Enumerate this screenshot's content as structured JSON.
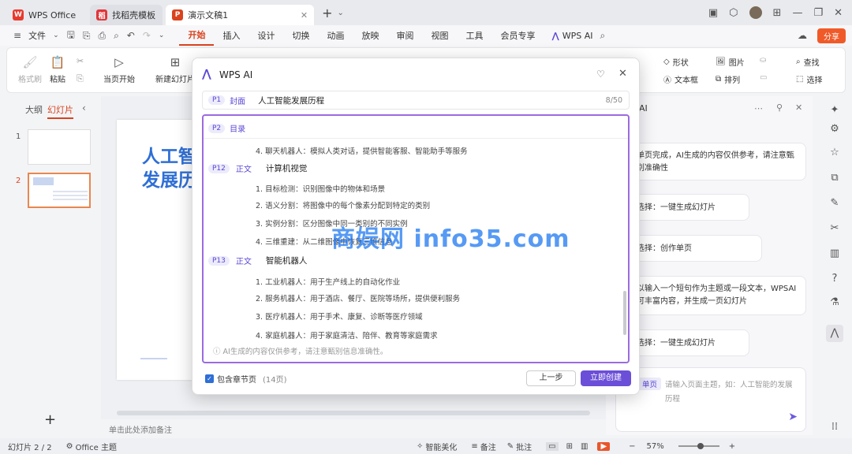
{
  "titlebar": {
    "tabs": [
      {
        "label": "WPS Office",
        "color": "#e63b2e"
      },
      {
        "label": "找稻壳模板",
        "color": "#e0353a"
      },
      {
        "label": "演示文稿1",
        "color": "#d9431f"
      }
    ],
    "add": "+"
  },
  "menubar": {
    "file": "文件",
    "items": [
      "开始",
      "插入",
      "设计",
      "切换",
      "动画",
      "放映",
      "审阅",
      "视图",
      "工具",
      "会员专享"
    ],
    "wps_ai": "WPS AI",
    "share": "分享"
  },
  "ribbon": {
    "format_painter": "格式刷",
    "paste": "粘贴",
    "from_current": "当页开始",
    "new_slide": "新建幻灯片",
    "shape": "形状",
    "picture": "图片",
    "find": "查找",
    "textbox": "文本框",
    "arrange": "排列",
    "select": "选择"
  },
  "leftpanel": {
    "outline_tab": "大纲",
    "slides_tab": "幻灯片",
    "slide_numbers": [
      "1",
      "2"
    ],
    "add": "+"
  },
  "slide": {
    "title_line1": "人工智",
    "title_line2": "发展历"
  },
  "notes_placeholder": "单击此处添加备注",
  "rightpanel": {
    "header": "AI",
    "messages": [
      "单页完成，AI生成的内容仅供参考，请注意甄别准确性",
      "选择：一键生成幻灯片",
      "选择：创作单页",
      "以输入一个短句作为主题或一段文本，WPSAI可丰富内容，并生成一页幻灯片",
      "选择：一键生成幻灯片"
    ],
    "input_tag": "单页",
    "input_placeholder": "请输入页面主题，如：人工智能的发展历程"
  },
  "dialog": {
    "title": "WPS AI",
    "p1_badge": "P1",
    "p1_type": "封面",
    "p1_title": "人工智能发展历程",
    "p1_count": "8/50",
    "p2_badge": "P2",
    "p2_type": "目录",
    "first_item": "4.   聊天机器人：模拟人类对话，提供智能客服、智能助手等服务",
    "sections": [
      {
        "badge": "P12",
        "type": "正文",
        "title": "计算机视觉",
        "items": [
          "1.   目标检测：识别图像中的物体和场景",
          "2.   语义分割：将图像中的每个像素分配到特定的类别",
          "3.   实例分割：区分图像中同一类别的不同实例",
          "4.   三维重建：从二维图像中恢复三维信息"
        ]
      },
      {
        "badge": "P13",
        "type": "正文",
        "title": "智能机器人",
        "items": [
          "1.   工业机器人：用于生产线上的自动化作业",
          "2.   服务机器人：用于酒店、餐厅、医院等场所，提供便利服务",
          "3.   医疗机器人：用于手术、康复、诊断等医疗领域",
          "4.   家庭机器人：用于家庭清洁、陪伴、教育等家庭需求"
        ]
      }
    ],
    "disclaimer": "AI生成的内容仅供参考，请注意甄别信息准确性。",
    "include_chapters": "包含章节页",
    "page_count": "(14页)",
    "prev_button": "上一步",
    "create_button": "立即创建"
  },
  "watermark": "商娱网 info35.com",
  "statusbar": {
    "slide_info": "幻灯片 2 / 2",
    "theme": "Office 主题",
    "beautify": "智能美化",
    "notes": "备注",
    "comments": "批注",
    "zoom": "57%"
  },
  "colors": {
    "accent": "#d9431f",
    "ai_purple": "#5a48d6",
    "slide_blue": "#2f6fd6"
  }
}
